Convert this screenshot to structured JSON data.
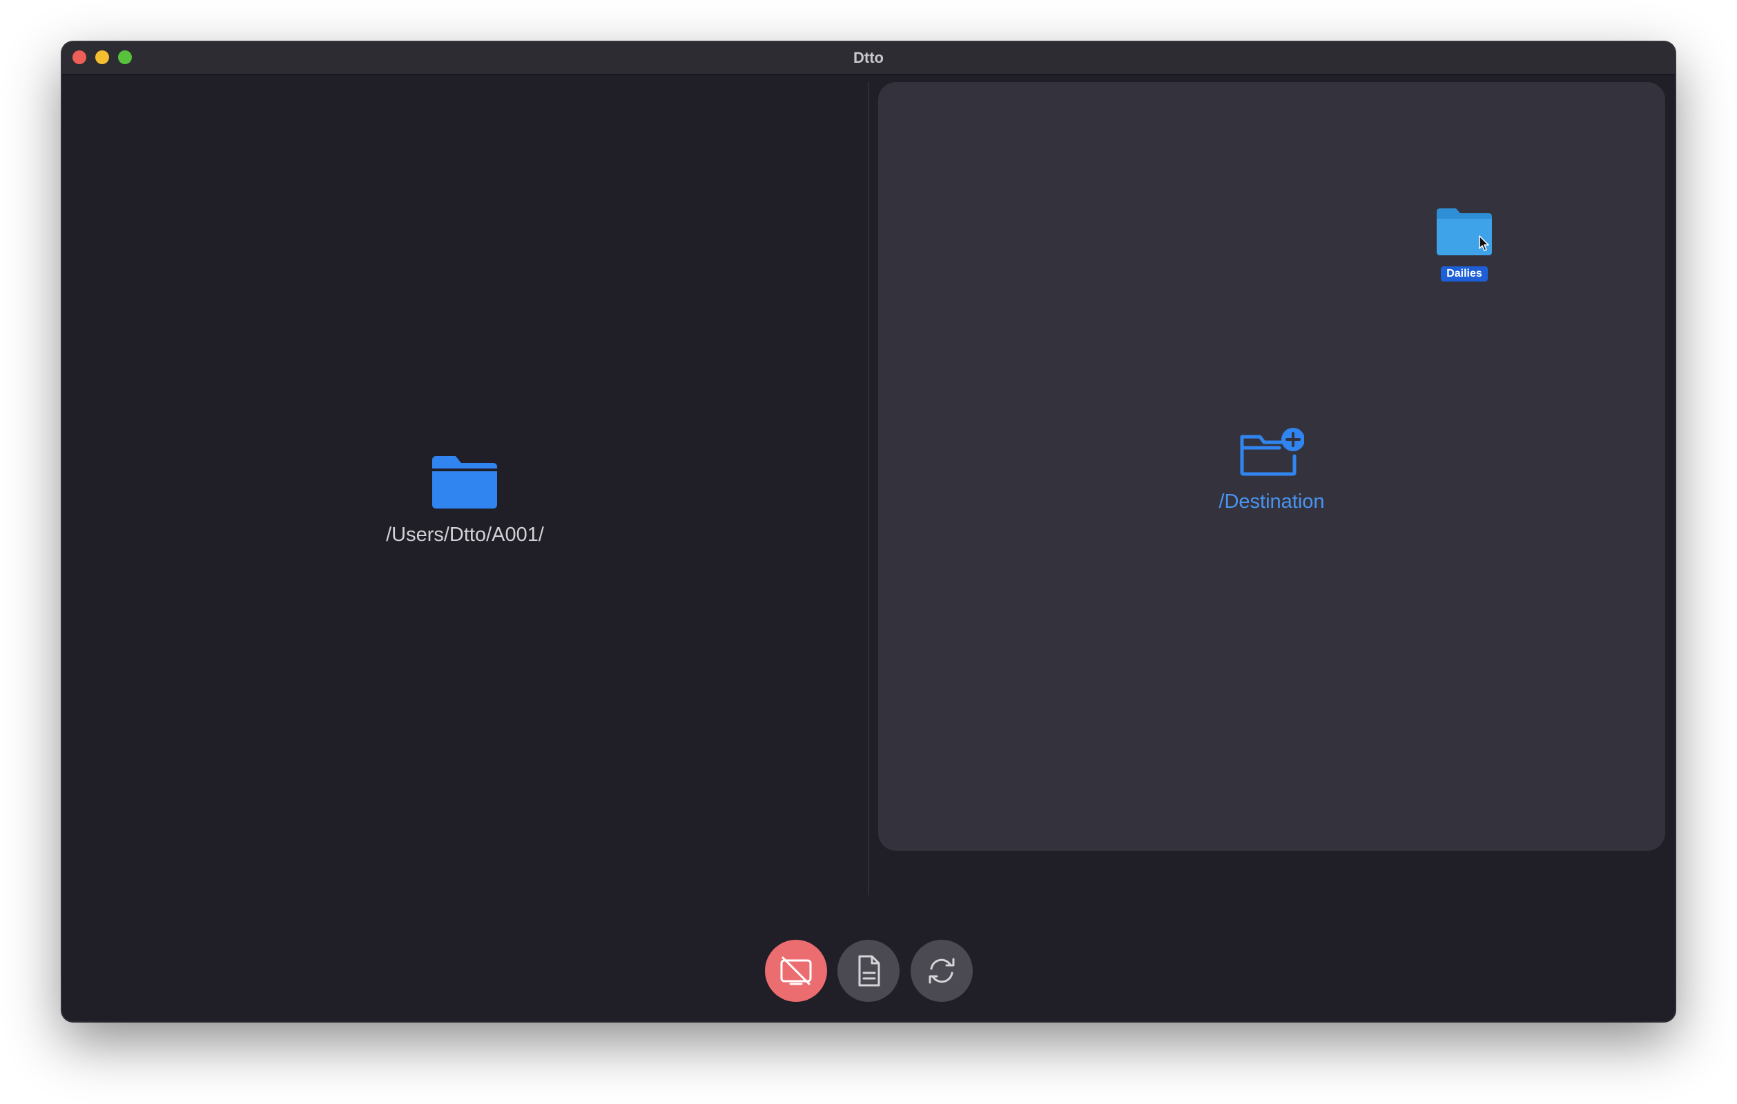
{
  "window": {
    "title": "Dtto"
  },
  "source": {
    "path": "/Users/Dtto/A001/",
    "icon": "folder-icon"
  },
  "destination": {
    "path": "/Destination",
    "icon": "folder-plus-icon"
  },
  "dragged_item": {
    "label": "Dailies",
    "icon": "folder-icon"
  },
  "toolbar": {
    "buttons": [
      {
        "name": "stop",
        "icon": "video-off-icon"
      },
      {
        "name": "log",
        "icon": "document-icon"
      },
      {
        "name": "sync",
        "icon": "refresh-icon"
      }
    ]
  },
  "colors": {
    "accent": "#4a93f0",
    "stop_button": "#ec6d6f",
    "window_bg": "#201f28",
    "pane_bg": "#34333d"
  }
}
